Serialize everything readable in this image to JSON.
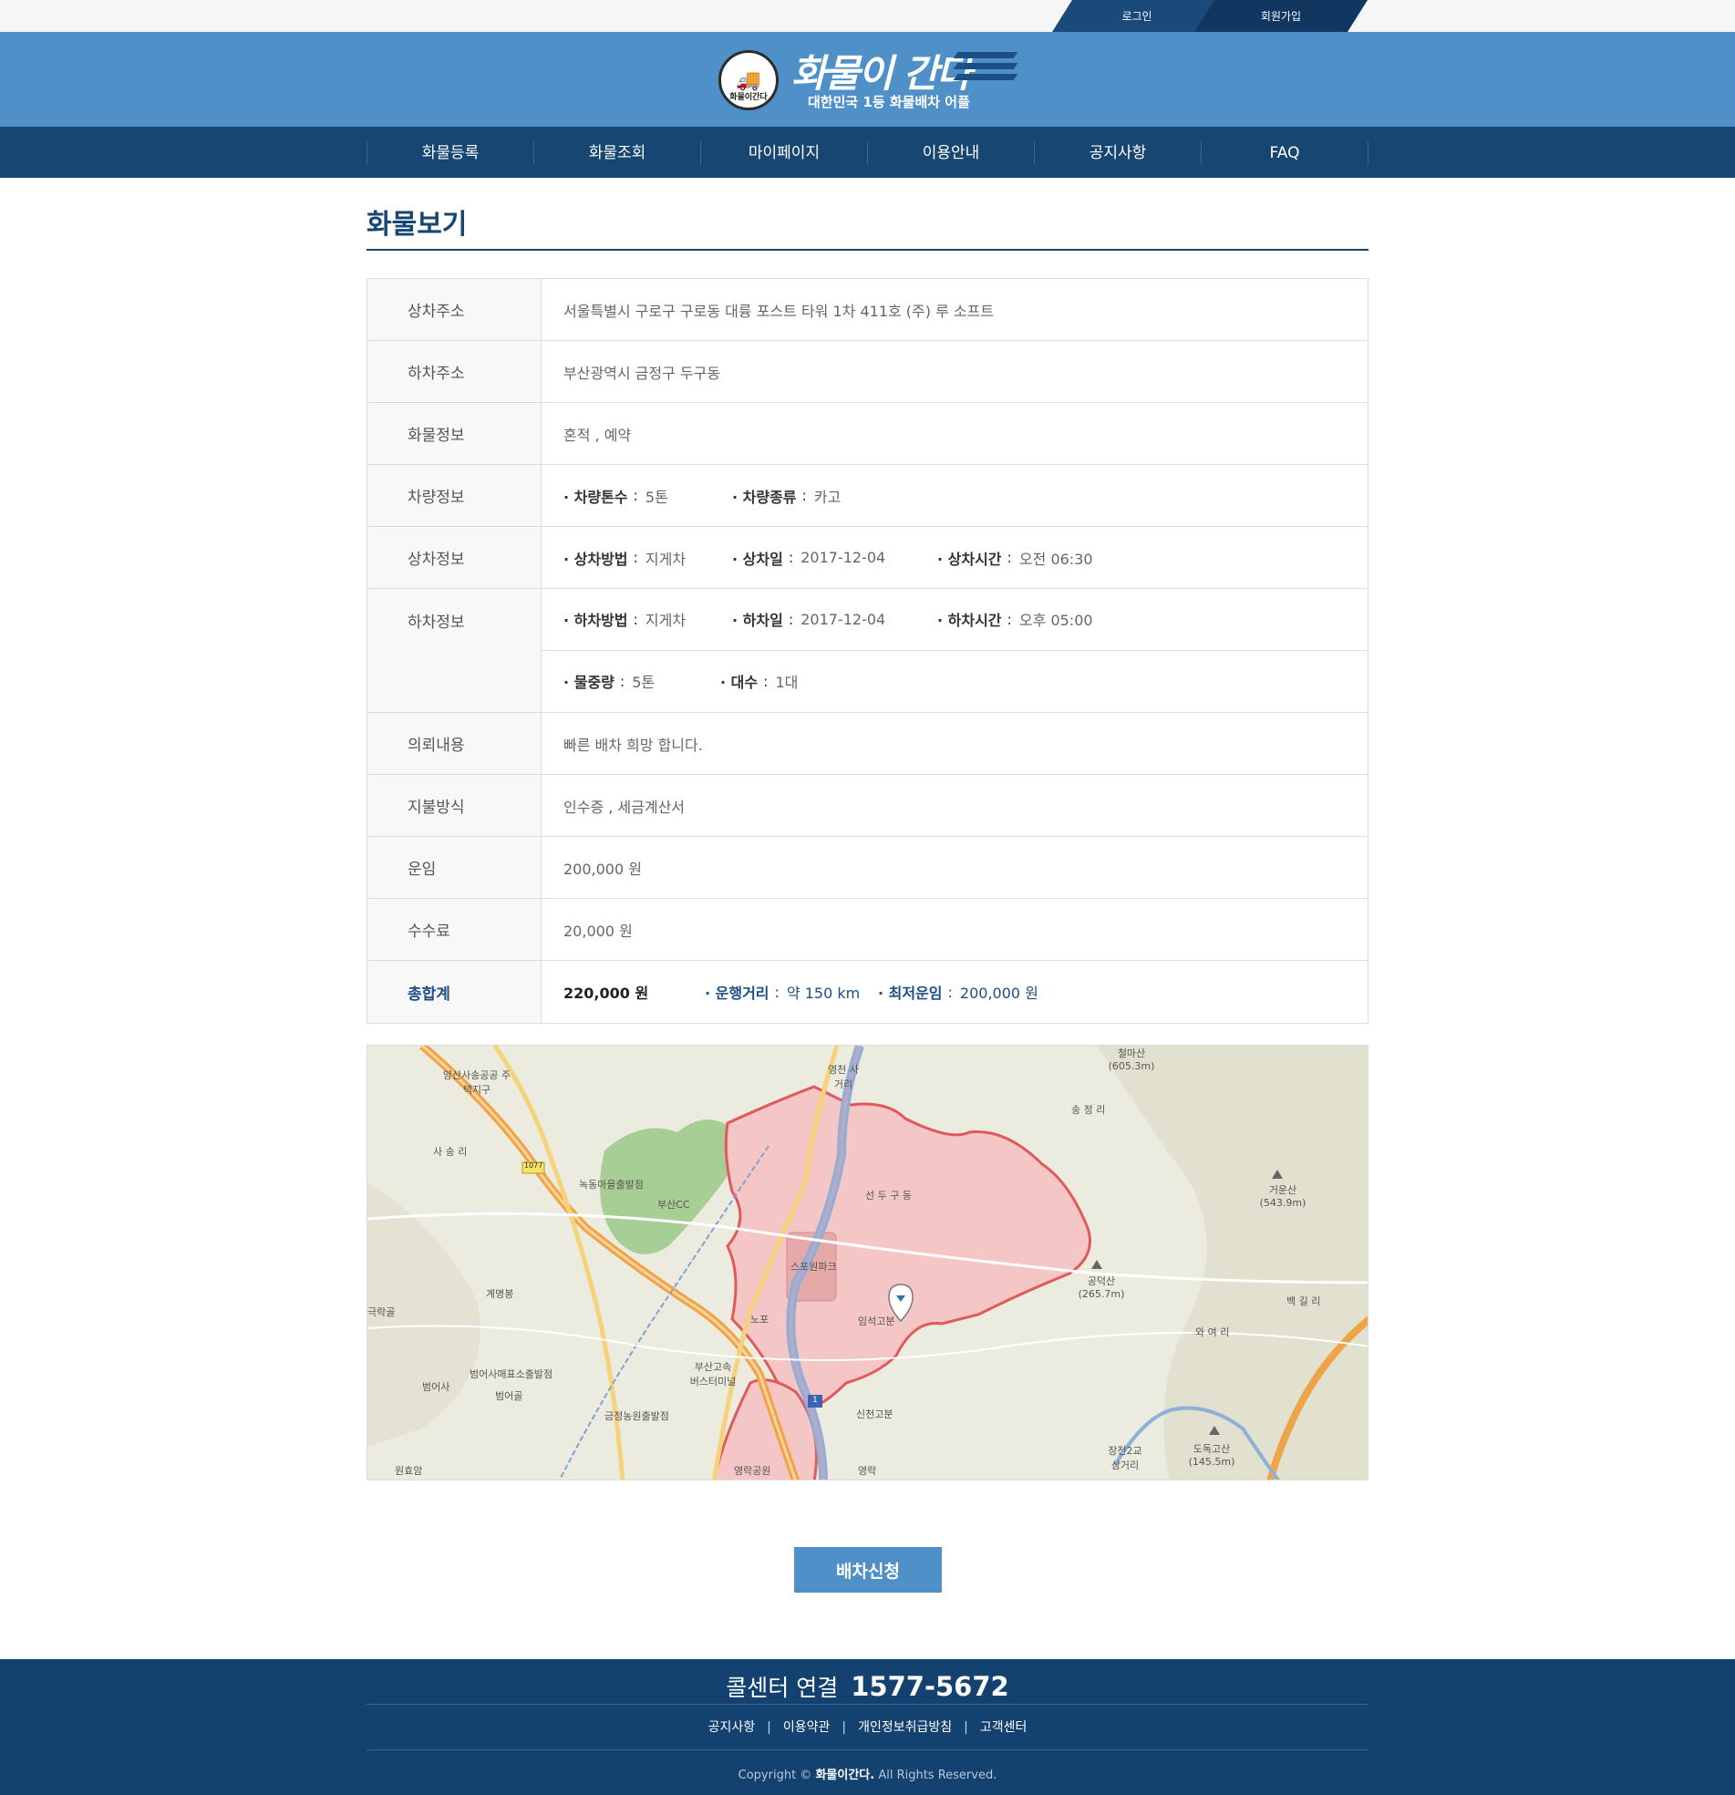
{
  "topbar": {
    "login": "로그인",
    "join": "회원가입"
  },
  "header": {
    "logo_title": "화물이 간다",
    "logo_subtitle": "대한민국 1등 화물배차 어플",
    "logo_mark_text": "화물이간다"
  },
  "nav": [
    "화물등록",
    "화물조회",
    "마이페이지",
    "이용안내",
    "공지사항",
    "FAQ"
  ],
  "page_title": "화물보기",
  "info": {
    "pickup_addr": {
      "label": "상차주소",
      "value": "서울특별시 구로구 구로동 대륭 포스트 타워 1차 411호 (주) 루 소프트"
    },
    "drop_addr": {
      "label": "하차주소",
      "value": "부산광역시 금정구 두구동"
    },
    "cargo": {
      "label": "화물정보",
      "value": "혼적 , 예약"
    },
    "vehicle": {
      "label": "차량정보",
      "tonnage_label": "· 차량톤수",
      "tonnage": "5톤",
      "type_label": "· 차량종류",
      "type": "카고"
    },
    "pickup": {
      "label": "상차정보",
      "method_label": "· 상차방법",
      "method": "지게차",
      "date_label": "· 상차일",
      "date": "2017-12-04",
      "time_label": "· 상차시간",
      "time": "오전 06:30"
    },
    "drop": {
      "label": "하차정보",
      "method_label": "· 하차방법",
      "method": "지게차",
      "date_label": "· 하차일",
      "date": "2017-12-04",
      "time_label": "· 하차시간",
      "time": "오후 05:00",
      "weight_label": "· 물중량",
      "weight": "5톤",
      "count_label": "· 대수",
      "count": "1대"
    },
    "request": {
      "label": "의뢰내용",
      "value": "빠른 배차 희망 합니다."
    },
    "payment": {
      "label": "지불방식",
      "value": "인수증 , 세금계산서"
    },
    "fare": {
      "label": "운임",
      "value": "200,000 원"
    },
    "fee": {
      "label": "수수료",
      "value": "20,000 원"
    },
    "total": {
      "label": "총합계",
      "value": "220,000 원",
      "distance_label": "· 운행거리",
      "distance": "약 150 km",
      "min_fare_label": "· 최저운임",
      "min_fare": "200,000 원"
    }
  },
  "map": {
    "labels": {
      "yangsan": "양산사송공공 주택지구",
      "songri": "사 송 리",
      "yeongcheon": "영천 사거리",
      "cheolmasan": "철마산 (605.3m)",
      "songjeongri": "송 정 리",
      "nongdong": "녹동마을출발점",
      "busancc": "부산CC",
      "seondugu": "선 두 구 동",
      "geounsan": "거운산 (543.9m)",
      "spoonpark": "스포원파크",
      "gongdeoksan": "공덕산 (265.7m)",
      "baekgilri": "백 길 리",
      "waeyeori": "와 여 리",
      "imseok": "임석고분",
      "gyemyeong": "계명봉",
      "geukrakgol": "극락골",
      "nopo": "노포",
      "terminal": "부산고속 버스터미널",
      "beomeosa_start": "범어사매표소출발점",
      "beomeosa": "범어사",
      "beomeogol": "범어골",
      "geumjeong_start": "금정농원출발점",
      "sincheon": "신천고분",
      "jangjeon": "장전2교 삼거리",
      "dodoksan": "도독고산 (145.5m)",
      "wonhyoam": "원효암",
      "yeongrak_park": "영락공원",
      "yeongrak": "영락",
      "road_1077": "1077",
      "road_1": "1"
    }
  },
  "dispatch_button": "배차신청",
  "footer": {
    "call_label": "콜센터 연결",
    "call_number": "1577-5672",
    "links": [
      "공지사항",
      "이용약관",
      "개인정보취급방침",
      "고객센터"
    ],
    "link_separator": "|",
    "copyright_prefix": "Copyright ©",
    "copyright_brand": "화물이간다.",
    "copyright_suffix": "All Rights Reserved."
  }
}
